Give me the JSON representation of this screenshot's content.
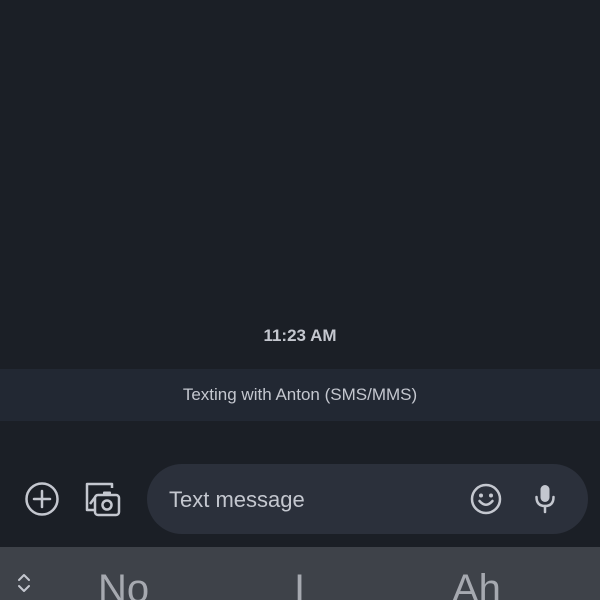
{
  "conversation": {
    "timestamp": "11:23 AM",
    "info_banner": "Texting with Anton (SMS/MMS)"
  },
  "composer": {
    "placeholder": "Text message",
    "icons": {
      "add": "add-circle-icon",
      "gallery": "gallery-camera-icon",
      "emoji": "emoji-icon",
      "mic": "microphone-icon"
    }
  },
  "keyboard": {
    "suggestions": [
      "No",
      "I",
      "Ah"
    ],
    "expand_icon": "chevron-up-down-icon"
  },
  "colors": {
    "background": "#1b1f26",
    "banner": "#222833",
    "input": "#2b303b",
    "suggestion_bar": "#3e4249",
    "text": "#c4c7cf"
  }
}
